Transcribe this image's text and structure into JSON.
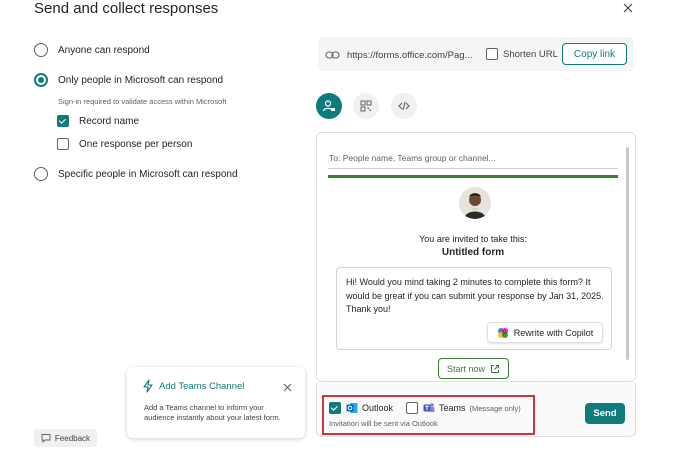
{
  "dialog": {
    "title": "Send and collect responses"
  },
  "options": {
    "anyone": "Anyone can respond",
    "org_only": "Only people in Microsoft can respond",
    "org_only_sub": "Sign-in required to validate access within Microsoft",
    "record_name": "Record name",
    "one_response": "One response per person",
    "specific": "Specific people in Microsoft can respond",
    "selected": "org_only",
    "record_name_checked": true,
    "one_response_checked": false
  },
  "link": {
    "url": "https://forms.office.com/Pag...",
    "shorten_label": "Shorten URL",
    "shorten_checked": false,
    "copy_label": "Copy link"
  },
  "share_methods": {
    "active": "invite",
    "icons": [
      "invite-people-icon",
      "qr-code-icon",
      "embed-code-icon"
    ]
  },
  "invite": {
    "to_placeholder": "To: People name, Teams group or channel...",
    "invited_text": "You are invited to take this:",
    "form_name": "Untitled form",
    "message": "Hi! Would you mind taking 2 minutes to complete this form? It would be great if you can submit your response by Jan 31, 2025. Thank you!",
    "copilot_label": "Rewrite with Copilot",
    "start_label": "Start now"
  },
  "send": {
    "outlook_label": "Outlook",
    "outlook_checked": true,
    "teams_label": "Teams",
    "teams_note": "(Message only)",
    "teams_checked": false,
    "via_text": "Invitation will be sent via Outlook",
    "send_label": "Send"
  },
  "teams_card": {
    "title": "Add Teams Channel",
    "description": "Add a Teams channel to inform your audience instantly about your latest form."
  },
  "feedback": {
    "label": "Feedback"
  },
  "colors": {
    "accent": "#0f7b7b",
    "green": "#3b7d33",
    "highlight": "#d13438"
  }
}
